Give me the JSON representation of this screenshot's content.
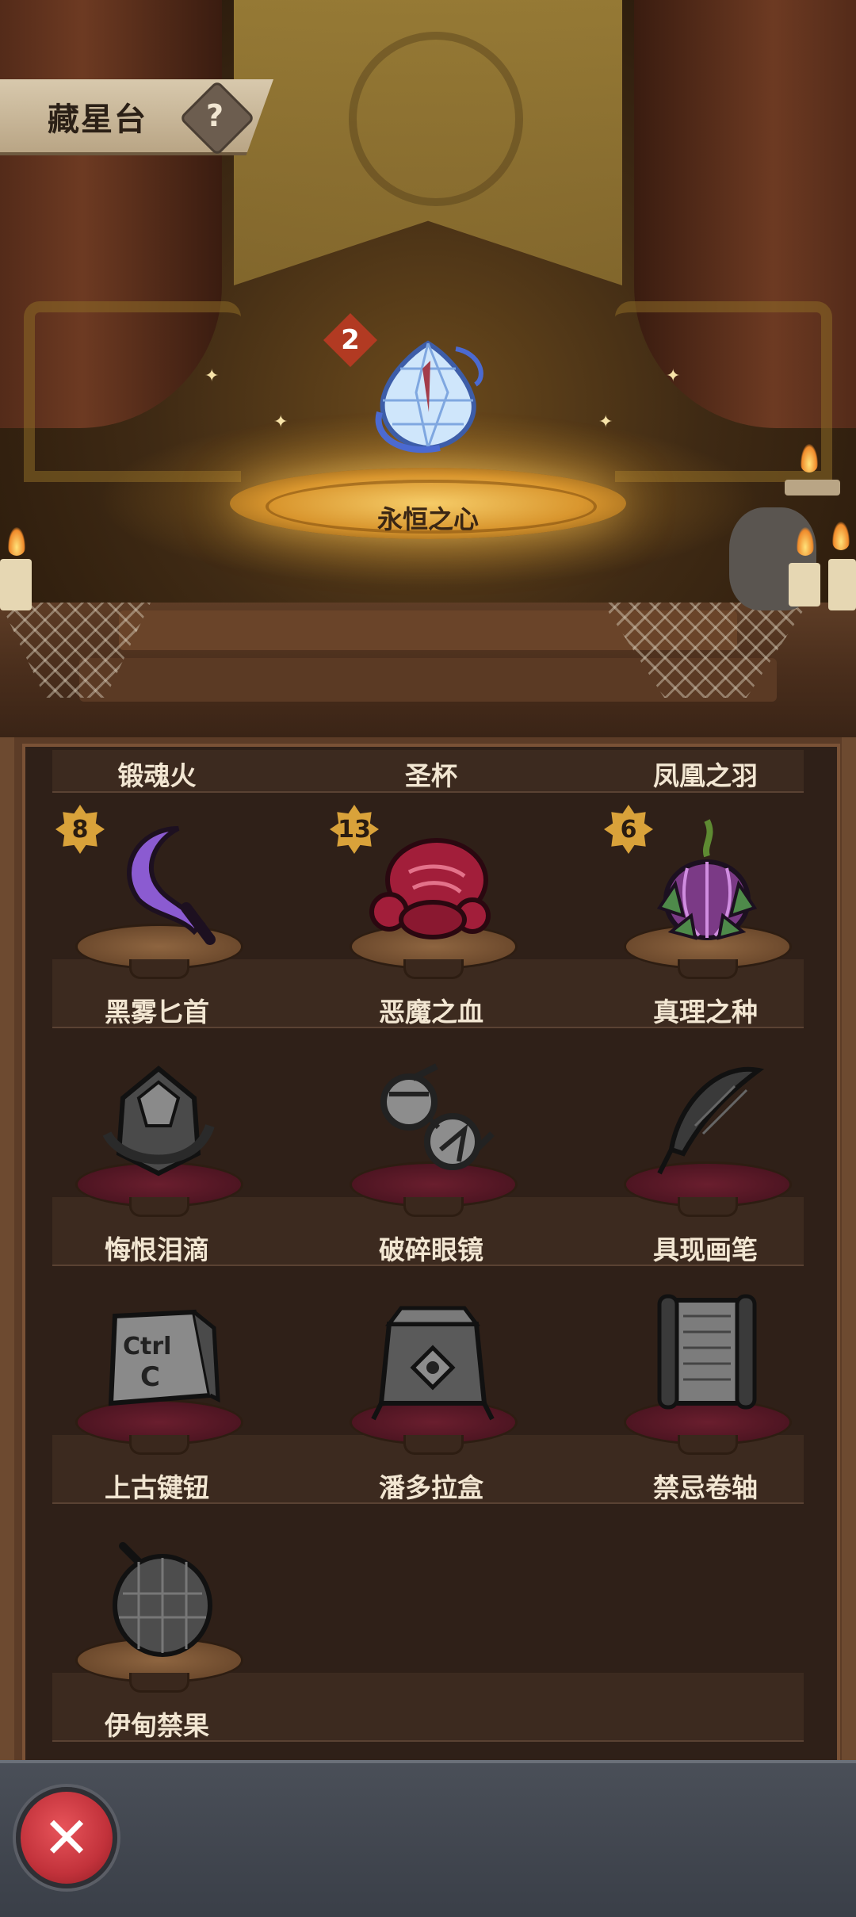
{
  "header": {
    "title": "藏星台",
    "help_icon": "question-mark-icon"
  },
  "featured": {
    "name": "永恒之心",
    "level": "2",
    "icon": "crystal-heart-icon"
  },
  "top_row_labels": [
    "锻魂火",
    "圣杯",
    "凤凰之羽"
  ],
  "items": [
    {
      "name": "黑雾匕首",
      "level": "8",
      "icon": "dagger-icon",
      "owned": true
    },
    {
      "name": "恶魔之血",
      "level": "13",
      "icon": "blood-blob-icon",
      "owned": true
    },
    {
      "name": "真理之种",
      "level": "6",
      "icon": "seed-bulb-icon",
      "owned": true
    },
    {
      "name": "悔恨泪滴",
      "level": "",
      "icon": "teardrop-gem-icon",
      "owned": false
    },
    {
      "name": "破碎眼镜",
      "level": "",
      "icon": "broken-glasses-icon",
      "owned": false
    },
    {
      "name": "具现画笔",
      "level": "",
      "icon": "quill-brush-icon",
      "owned": false
    },
    {
      "name": "上古键钮",
      "level": "",
      "icon": "keycap-icon",
      "owned": false
    },
    {
      "name": "潘多拉盒",
      "level": "",
      "icon": "pandora-box-icon",
      "owned": false
    },
    {
      "name": "禁忌卷轴",
      "level": "",
      "icon": "scroll-icon",
      "owned": false
    },
    {
      "name": "伊甸禁果",
      "level": "",
      "icon": "forbidden-fruit-icon",
      "owned": false
    }
  ],
  "keycap_text": {
    "line1": "Ctrl",
    "line2": "C"
  },
  "footer": {
    "close_icon": "close-icon"
  },
  "colors": {
    "gold": "#d9a23a",
    "badge_red": "#b23a22",
    "close_red": "#c2323b",
    "label": "#f2e6d2"
  }
}
